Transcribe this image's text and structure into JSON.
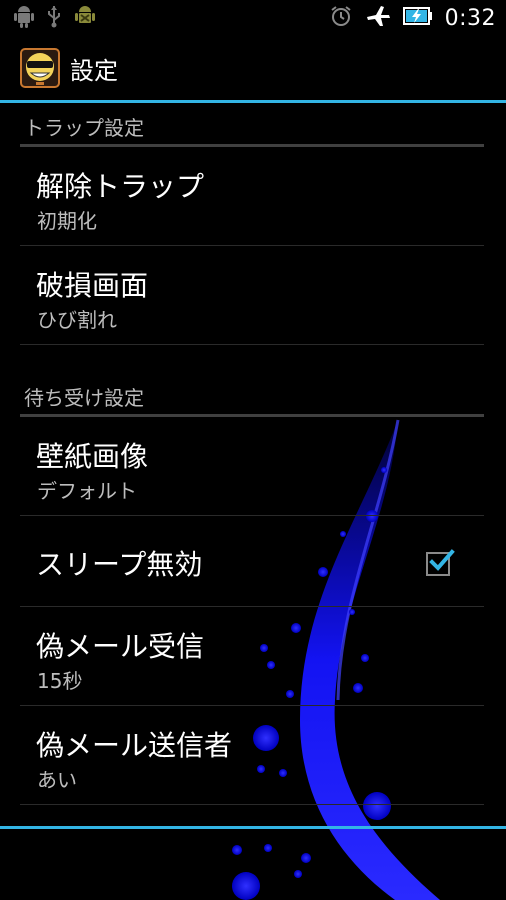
{
  "statusbar": {
    "time": "0:32",
    "left_icons": [
      "android-debug-icon",
      "usb-icon",
      "android-bug-icon"
    ],
    "right_icons": [
      "alarm-icon",
      "airplane-mode-icon",
      "battery-charging-icon"
    ]
  },
  "titlebar": {
    "title": "設定",
    "icon": "app-face-icon"
  },
  "sections": [
    {
      "header": "トラップ設定",
      "items": [
        {
          "title": "解除トラップ",
          "summary": "初期化"
        },
        {
          "title": "破損画面",
          "summary": "ひび割れ"
        }
      ]
    },
    {
      "header": "待ち受け設定",
      "items": [
        {
          "title": "壁紙画像",
          "summary": "デフォルト"
        },
        {
          "title": "スリープ無効",
          "checked": true
        },
        {
          "title": "偽メール受信",
          "summary": "15秒"
        },
        {
          "title": "偽メール送信者",
          "summary": "あい"
        }
      ]
    }
  ],
  "colors": {
    "accent": "#33b5e5",
    "wallpaper_swirl": "#1a1aff",
    "background": "#000000"
  }
}
